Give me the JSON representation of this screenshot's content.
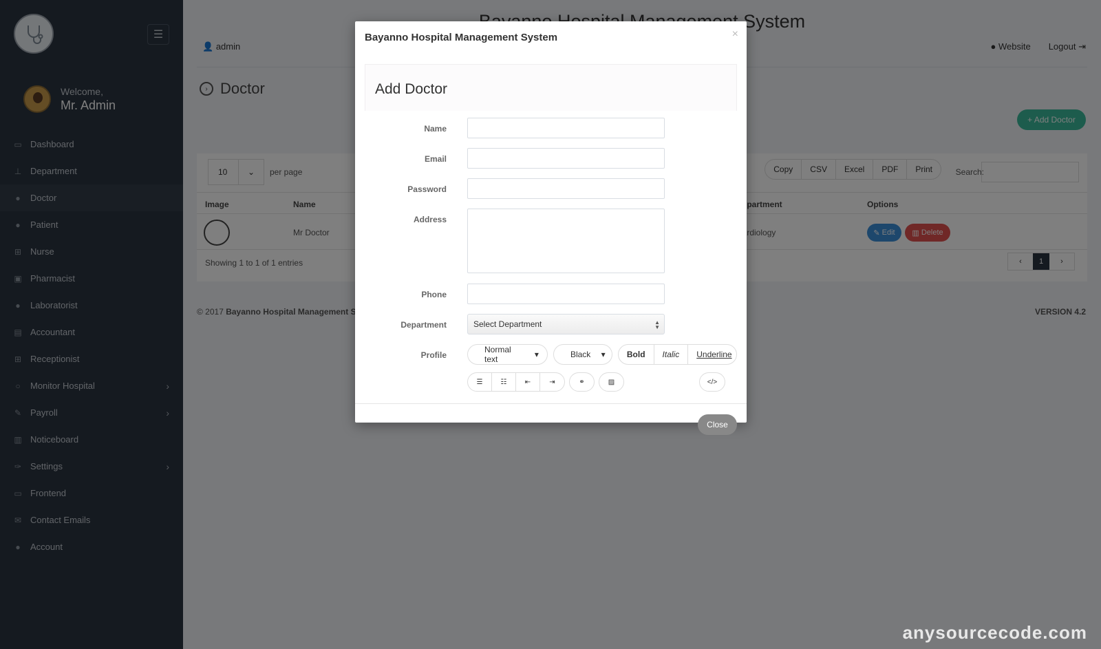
{
  "header": {
    "system_title": "Bayanno Hospital Management System",
    "user": "admin",
    "website_label": "Website",
    "logout_label": "Logout"
  },
  "sidebar": {
    "welcome": "Welcome,",
    "user_name": "Mr. Admin",
    "items": [
      {
        "label": "Dashboard",
        "icon": "monitor-icon"
      },
      {
        "label": "Department",
        "icon": "sitemap-icon"
      },
      {
        "label": "Doctor",
        "icon": "user-md-icon"
      },
      {
        "label": "Patient",
        "icon": "user-icon"
      },
      {
        "label": "Nurse",
        "icon": "plus-square-icon"
      },
      {
        "label": "Pharmacist",
        "icon": "medkit-icon"
      },
      {
        "label": "Laboratorist",
        "icon": "user-icon"
      },
      {
        "label": "Accountant",
        "icon": "money-icon"
      },
      {
        "label": "Receptionist",
        "icon": "plus-square-icon"
      },
      {
        "label": "Monitor Hospital",
        "icon": "circle-icon"
      },
      {
        "label": "Payroll",
        "icon": "pencil-icon"
      },
      {
        "label": "Noticeboard",
        "icon": "clipboard-icon"
      },
      {
        "label": "Settings",
        "icon": "wrench-icon"
      },
      {
        "label": "Frontend",
        "icon": "laptop-icon"
      },
      {
        "label": "Contact Emails",
        "icon": "envelope-icon"
      },
      {
        "label": "Account",
        "icon": "user-icon"
      }
    ]
  },
  "page": {
    "title": "Doctor",
    "add_button": "+ Add Doctor",
    "per_page_value": "10",
    "per_page_label": "per page",
    "export_buttons": [
      "Copy",
      "CSV",
      "Excel",
      "PDF",
      "Print"
    ],
    "search_label": "Search:",
    "columns": [
      "Image",
      "Name",
      "Department",
      "Options"
    ],
    "rows": [
      {
        "name": "Mr Doctor",
        "department": "Cardiology",
        "edit": "Edit",
        "delete": "Delete"
      }
    ],
    "showing": "Showing 1 to 1 of 1 entries",
    "current_page": "1",
    "footer_prefix": "© 2017 ",
    "footer_brand": "Bayanno Hospital Management S",
    "version": "VERSION 4.2",
    "watermark": "anysourcecode.com"
  },
  "modal": {
    "title": "Bayanno Hospital Management System",
    "form_title": "Add Doctor",
    "labels": {
      "name": "Name",
      "email": "Email",
      "password": "Password",
      "address": "Address",
      "phone": "Phone",
      "department": "Department",
      "profile": "Profile"
    },
    "department_placeholder": "Select Department",
    "toolbar": {
      "text_style": "Normal text",
      "color": "Black",
      "bold": "Bold",
      "italic": "Italic",
      "underline": "Underline"
    },
    "close_button": "Close"
  }
}
